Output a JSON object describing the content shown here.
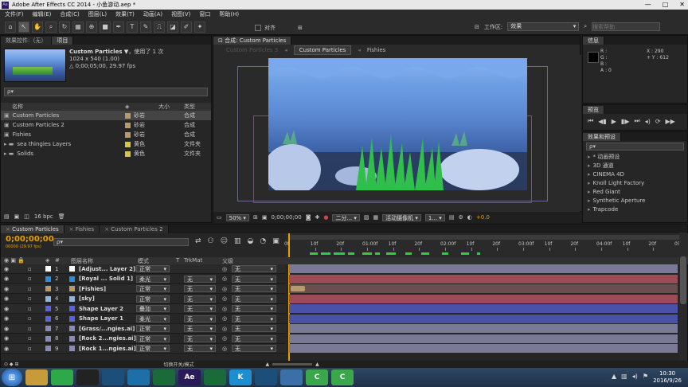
{
  "window": {
    "title": "Adobe After Effects CC 2014 - 小鱼游动.aep *",
    "app_icon": "Ae"
  },
  "menu": [
    "文件(F)",
    "编辑(E)",
    "合成(C)",
    "图层(L)",
    "效果(T)",
    "动画(A)",
    "视图(V)",
    "窗口",
    "帮助(H)"
  ],
  "toolbar": {
    "snap_label": "对齐",
    "workspace_label": "工作区:",
    "workspace_value": "效果",
    "search_placeholder": "搜索帮助"
  },
  "project": {
    "tabs": [
      "效果控件:（无）",
      "项目"
    ],
    "preview": {
      "name": "Custom Particles ▼",
      "usage": "，使用了 1 次",
      "size": "1024 x 540 (1.00)",
      "duration": "△ 0;00;05;00, 29.97 fps"
    },
    "search_placeholder": "ρ▾",
    "columns": {
      "name": "名称",
      "size": "大小",
      "type": "类型"
    },
    "items": [
      {
        "name": "Custom Particles",
        "label": "砂岩",
        "type": "合成",
        "color": "#b89a6a",
        "icon": "comp-icon"
      },
      {
        "name": "Custom Particles 2",
        "label": "砂岩",
        "type": "合成",
        "color": "#b89a6a",
        "icon": "comp-icon"
      },
      {
        "name": "Fishies",
        "label": "砂岩",
        "type": "合成",
        "color": "#b89a6a",
        "icon": "comp-icon"
      },
      {
        "name": "sea thingies Layers",
        "label": "黄色",
        "type": "文件夹",
        "color": "#d8c34a",
        "icon": "folder-icon"
      },
      {
        "name": "Solids",
        "label": "黄色",
        "type": "文件夹",
        "color": "#d8c34a",
        "icon": "folder-icon"
      }
    ],
    "bpc": "16 bpc"
  },
  "comp_viewer": {
    "tab": "合成: Custom Particles",
    "breadcrumbs": [
      "Custom Particles 3",
      "Custom Particles",
      "Fishies"
    ],
    "zoom": "50%",
    "timecode": "0;00;00;00",
    "resolution": "二分...",
    "camera": "活动摄像机",
    "views": "1...",
    "exposure": "+0.0"
  },
  "info": {
    "title": "信息",
    "rgba": [
      "R :",
      "G :",
      "B :",
      "A : 0"
    ],
    "x": "X : 290",
    "y": "+ Y : 612"
  },
  "preview_panel": {
    "title": "预览"
  },
  "effects": {
    "title": "效果和预设",
    "search_placeholder": "ρ▾",
    "items": [
      "* 动画预设",
      "3D 通道",
      "CINEMA 4D",
      "Knoll Light Factory",
      "Red Giant",
      "Synthetic Aperture",
      "Trapcode"
    ]
  },
  "timeline": {
    "tabs": [
      "Custom Particles",
      "Fishies",
      "Custom Particles 2"
    ],
    "timecode": "0;00;00;00",
    "fps_info": "00000 (29.97 fps)",
    "search_placeholder": "ρ▾",
    "columns": {
      "layer_name": "图层名称",
      "mode": "模式",
      "t": "T",
      "trkmat": "TrkMat",
      "parent": "父级"
    },
    "ruler": [
      "0f",
      "10f",
      "20f",
      "01:00f",
      "10f",
      "20f",
      "02:00f",
      "10f",
      "20f",
      "03:00f",
      "10f",
      "20f",
      "04:00f",
      "10f",
      "20f",
      "05:0"
    ],
    "layers": [
      {
        "num": "1",
        "name": "[Adjust... Layer 2]",
        "mode": "正常",
        "trkmat": "",
        "parent": "无",
        "color": "#ffffff",
        "bar": "#7a7a96"
      },
      {
        "num": "2",
        "name": "[Royal ... Solid 1]",
        "mode": "柔光",
        "trkmat": "无",
        "parent": "无",
        "color": "#2a8fd8",
        "bar": "#9b4d57"
      },
      {
        "num": "3",
        "name": "[Fishies]",
        "mode": "正常",
        "trkmat": "无",
        "parent": "无",
        "color": "#b89a6a",
        "bar": "#6a4f4f"
      },
      {
        "num": "4",
        "name": "[sky]",
        "mode": "正常",
        "trkmat": "无",
        "parent": "无",
        "color": "#8fb4e0",
        "bar": "#9b4d57"
      },
      {
        "num": "5",
        "name": "Shape Layer 2",
        "mode": "叠加",
        "trkmat": "无",
        "parent": "无",
        "color": "#5c62d8",
        "bar": "#4a52a8"
      },
      {
        "num": "6",
        "name": "Shape Layer 1",
        "mode": "柔光",
        "trkmat": "无",
        "parent": "无",
        "color": "#5c62d8",
        "bar": "#4a52a8"
      },
      {
        "num": "7",
        "name": "[Grass/...ngies.ai]",
        "mode": "正常",
        "trkmat": "无",
        "parent": "无",
        "color": "#8a8ab8",
        "bar": "#7a7a96"
      },
      {
        "num": "8",
        "name": "[Rock 2...ngies.ai]",
        "mode": "正常",
        "trkmat": "无",
        "parent": "无",
        "color": "#8a8ab8",
        "bar": "#7a7a96"
      },
      {
        "num": "9",
        "name": "[Rock 1...ngies.ai]",
        "mode": "正常",
        "trkmat": "无",
        "parent": "无",
        "color": "#8a8ab8",
        "bar": "#7a7a96"
      }
    ],
    "footer": "切换开关/模式"
  },
  "taskbar": {
    "time": "10:30",
    "date": "2016/9/26",
    "apps": [
      {
        "name": "folder-app-icon",
        "label": "",
        "bg": "#c79a3a"
      },
      {
        "name": "browser-app-icon",
        "label": "",
        "bg": "#2fa84a"
      },
      {
        "name": "qq-app-icon",
        "label": "",
        "bg": "#222"
      },
      {
        "name": "plane-app-icon",
        "label": "",
        "bg": "#1b4f7a"
      },
      {
        "name": "link-app-icon",
        "label": "",
        "bg": "#1d6fa8"
      },
      {
        "name": "media-app-icon",
        "label": "",
        "bg": "#1b6a3a"
      },
      {
        "name": "ae-app-icon",
        "label": "Ae",
        "bg": "#2a1a5a"
      },
      {
        "name": "player-app-icon",
        "label": "",
        "bg": "#1b6a3a"
      },
      {
        "name": "k-app-icon",
        "label": "K",
        "bg": "#1d8fd0"
      },
      {
        "name": "bird-app-icon",
        "label": "",
        "bg": "#1b4f7a"
      },
      {
        "name": "calc-app-icon",
        "label": "",
        "bg": "#3a6fa8"
      },
      {
        "name": "c-app-icon",
        "label": "C",
        "bg": "#3aa84a"
      },
      {
        "name": "c2-app-icon",
        "label": "C",
        "bg": "#3aa84a"
      }
    ]
  },
  "colors": {
    "accent": "#e8a000",
    "panel": "#262626",
    "timecode": "#e8a000",
    "sky_top": "#6d9ee4",
    "water": "#3b5fa8"
  }
}
